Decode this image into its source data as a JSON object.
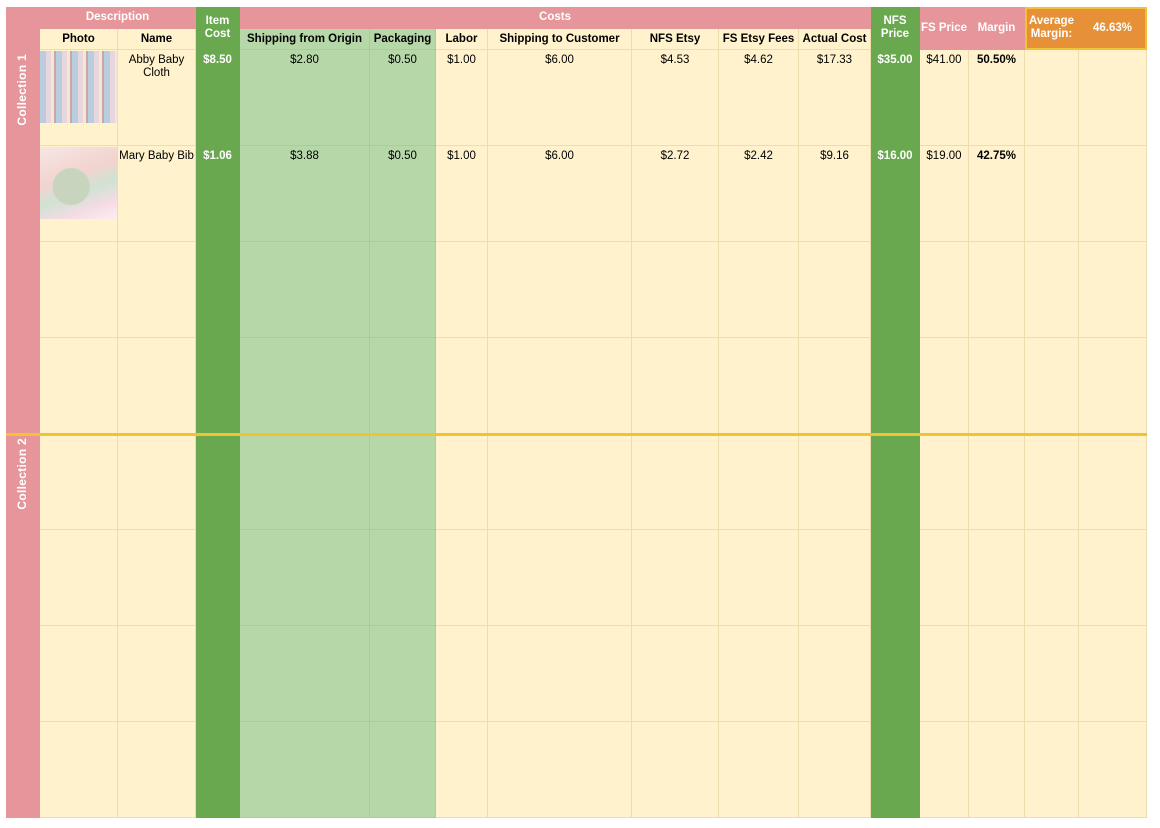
{
  "colors": {
    "pink": "#e6969a",
    "cream": "#fff2cc",
    "dark_green": "#6aa84f",
    "light_green": "#b6d7a8",
    "orange": "#e69138",
    "highlight": "#f1c232"
  },
  "headers": {
    "description": "Description",
    "photo": "Photo",
    "name": "Name",
    "item_cost": "Item Cost",
    "costs": "Costs",
    "shipping_from_origin": "Shipping from Origin",
    "packaging": "Packaging",
    "labor": "Labor",
    "shipping_to_customer": "Shipping to Customer",
    "nfs_etsy": "NFS Etsy",
    "fs_etsy_fees": "FS Etsy Fees",
    "actual_cost": "Actual Cost",
    "nfs_price": "NFS Price",
    "fs_price": "FS Price",
    "margin": "Margin",
    "average_margin_label": "Average Margin:",
    "average_margin_value": "46.63%"
  },
  "collections": [
    "Collection 1",
    "Collection 2"
  ],
  "rows": [
    {
      "photo": "baby-clothes-on-rack",
      "name": "Abby Baby Cloth",
      "item_cost": "$8.50",
      "shipping_from_origin": "$2.80",
      "packaging": "$0.50",
      "labor": "$1.00",
      "shipping_to_customer": "$6.00",
      "nfs_etsy": "$4.53",
      "fs_etsy_fees": "$4.62",
      "actual_cost": "$17.33",
      "nfs_price": "$35.00",
      "fs_price": "$41.00",
      "margin": "50.50%"
    },
    {
      "photo": "pastel-silicone-bibs",
      "name": "Mary Baby Bib",
      "item_cost": "$1.06",
      "shipping_from_origin": "$3.88",
      "packaging": "$0.50",
      "labor": "$1.00",
      "shipping_to_customer": "$6.00",
      "nfs_etsy": "$2.72",
      "fs_etsy_fees": "$2.42",
      "actual_cost": "$9.16",
      "nfs_price": "$16.00",
      "fs_price": "$19.00",
      "margin": "42.75%"
    }
  ]
}
